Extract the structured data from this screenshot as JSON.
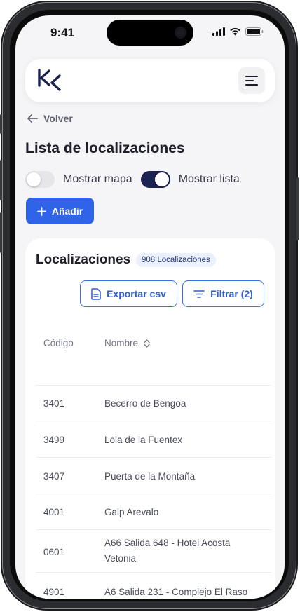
{
  "status": {
    "time": "9:41"
  },
  "header": {
    "logo": "KS-logo"
  },
  "nav": {
    "back_label": "Volver"
  },
  "page": {
    "title": "Lista de localizaciones"
  },
  "toggles": {
    "map_label": "Mostrar mapa",
    "map_on": false,
    "list_label": "Mostrar lista",
    "list_on": true
  },
  "actions": {
    "add_label": "Añadir",
    "export_label": "Exportar csv",
    "filter_label": "Filtrar (2)"
  },
  "list": {
    "title": "Localizaciones",
    "count_badge": "908 Localizaciones",
    "columns": {
      "code": "Código",
      "name": "Nombre"
    },
    "rows": [
      {
        "code": "3401",
        "name": "Becerro de Bengoa"
      },
      {
        "code": "3499",
        "name": "Lola de la Fuentex"
      },
      {
        "code": "3407",
        "name": "Puerta de la Montaña"
      },
      {
        "code": "4001",
        "name": "Galp Arevalo"
      },
      {
        "code": "0601",
        "name_line1": "A66 Salida 648 - Hotel Acosta",
        "name_line2": "Vetonia"
      },
      {
        "code": "4901",
        "name": "A6 Salida 231 - Complejo El Raso"
      }
    ]
  },
  "colors": {
    "primary": "#2f63e8",
    "toggle_on": "#1c2350",
    "accent_outline": "#3a6fe8"
  }
}
